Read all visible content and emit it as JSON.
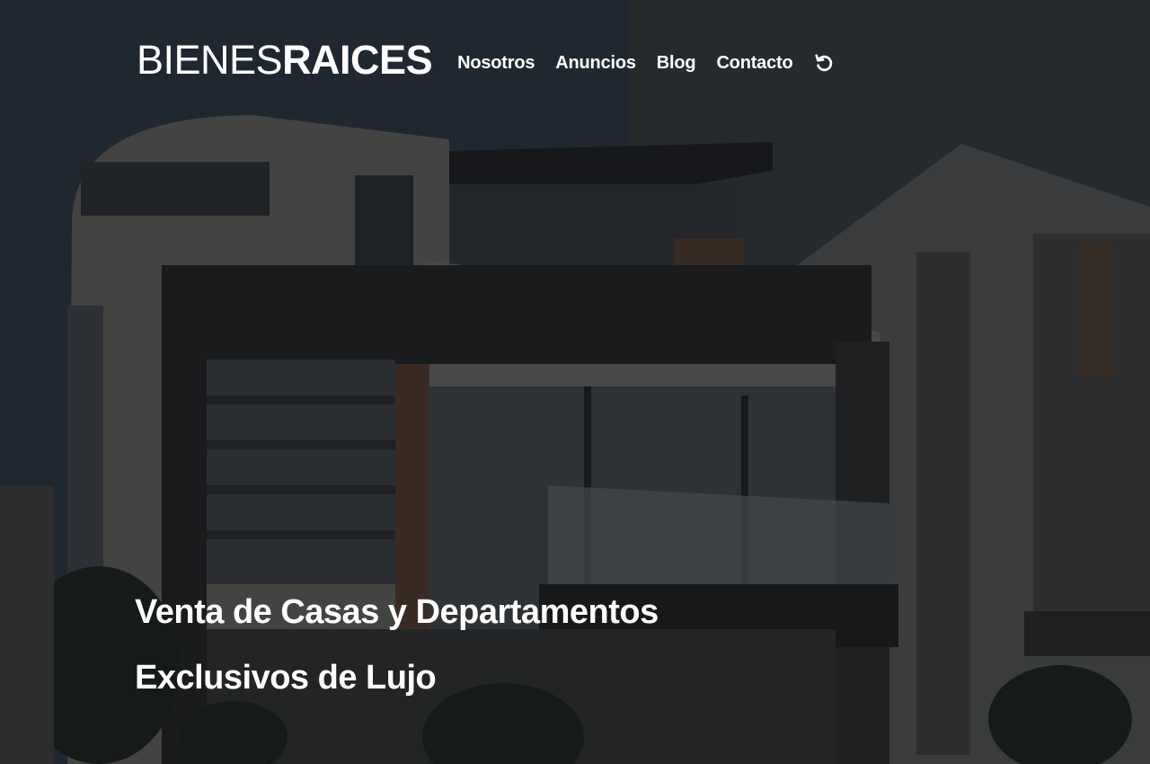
{
  "header": {
    "logo_light": "BIENES",
    "logo_bold": "RAICES",
    "nav": [
      {
        "label": "Nosotros"
      },
      {
        "label": "Anuncios"
      },
      {
        "label": "Blog"
      },
      {
        "label": "Contacto"
      }
    ],
    "mode_toggle_icon": "refresh-icon"
  },
  "hero": {
    "line1": "Venta de Casas y Departamentos",
    "line2": "Exclusivos de Lujo",
    "background_image": "modern-house-photo",
    "overlay_color": "#000000"
  }
}
